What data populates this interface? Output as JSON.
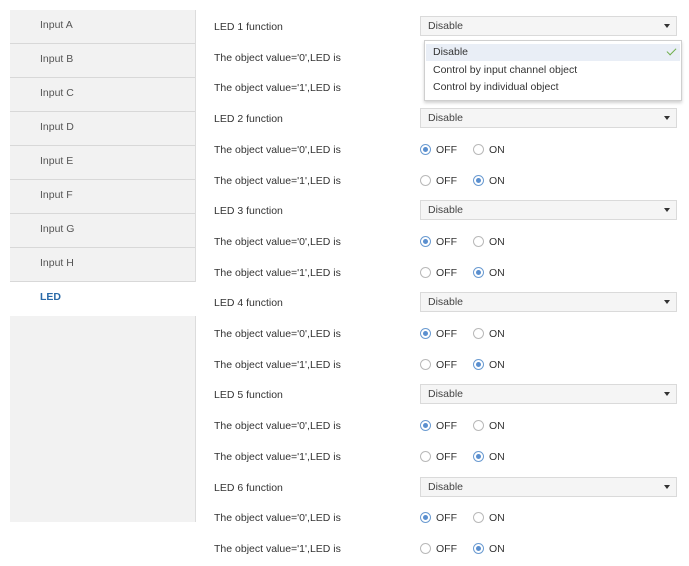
{
  "sidebar": {
    "items": [
      {
        "label": "Input A"
      },
      {
        "label": "Input B"
      },
      {
        "label": "Input C"
      },
      {
        "label": "Input D"
      },
      {
        "label": "Input E"
      },
      {
        "label": "Input F"
      },
      {
        "label": "Input G"
      },
      {
        "label": "Input H"
      },
      {
        "label": "LED",
        "active": true
      }
    ]
  },
  "main": {
    "rows": [
      {
        "type": "select",
        "label": "LED 1 function",
        "value": "Disable"
      },
      {
        "type": "text",
        "label": "The object value='0',LED is"
      },
      {
        "type": "text",
        "label": "The object value='1',LED is"
      },
      {
        "type": "select",
        "label": "LED 2 function",
        "value": "Disable"
      },
      {
        "type": "radio",
        "label": "The object value='0',LED is",
        "options": [
          "OFF",
          "ON"
        ],
        "selected": 0
      },
      {
        "type": "radio",
        "label": "The object value='1',LED is",
        "options": [
          "OFF",
          "ON"
        ],
        "selected": 1
      },
      {
        "type": "select",
        "label": "LED 3 function",
        "value": "Disable"
      },
      {
        "type": "radio",
        "label": "The object value='0',LED is",
        "options": [
          "OFF",
          "ON"
        ],
        "selected": 0
      },
      {
        "type": "radio",
        "label": "The object value='1',LED is",
        "options": [
          "OFF",
          "ON"
        ],
        "selected": 1
      },
      {
        "type": "select",
        "label": "LED 4 function",
        "value": "Disable"
      },
      {
        "type": "radio",
        "label": "The object value='0',LED is",
        "options": [
          "OFF",
          "ON"
        ],
        "selected": 0
      },
      {
        "type": "radio",
        "label": "The object value='1',LED is",
        "options": [
          "OFF",
          "ON"
        ],
        "selected": 1
      },
      {
        "type": "select",
        "label": "LED 5 function",
        "value": "Disable"
      },
      {
        "type": "radio",
        "label": "The object value='0',LED is",
        "options": [
          "OFF",
          "ON"
        ],
        "selected": 0
      },
      {
        "type": "radio",
        "label": "The object value='1',LED is",
        "options": [
          "OFF",
          "ON"
        ],
        "selected": 1
      },
      {
        "type": "select",
        "label": "LED 6 function",
        "value": "Disable"
      },
      {
        "type": "radio",
        "label": "The object value='0',LED is",
        "options": [
          "OFF",
          "ON"
        ],
        "selected": 0
      },
      {
        "type": "radio",
        "label": "The object value='1',LED is",
        "options": [
          "OFF",
          "ON"
        ],
        "selected": 1
      }
    ],
    "dropdown_popup": {
      "options": [
        {
          "label": "Disable",
          "selected": true
        },
        {
          "label": "Control by input channel object"
        },
        {
          "label": "Control by individual object"
        }
      ]
    }
  },
  "icons": {
    "dropdown": "chevron-down-icon",
    "popup_check": "check-icon"
  },
  "colors": {
    "active_tab": "#2a6aa8",
    "radio_checked": "#5a8fcf",
    "check": "#6fae4c",
    "sidebar_bg": "#f2f2f2"
  }
}
